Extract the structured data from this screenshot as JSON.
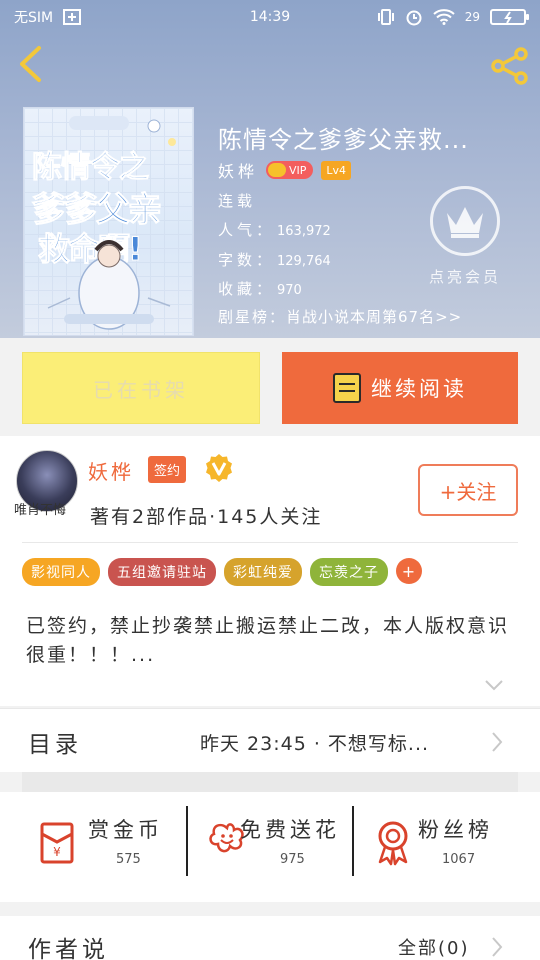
{
  "status_bar": {
    "carrier": "无SIM",
    "time": "14:39",
    "battery": "29"
  },
  "book": {
    "title": "陈情令之爹爹父亲救...",
    "cover_text_main": "陈情令之",
    "cover_text_sub": "爹爹父亲",
    "cover_text_last": "救命啊!",
    "author": "妖桦",
    "vip_label": "VIP",
    "level_label": "Lv4",
    "status": "连载",
    "popularity_label": "人气：",
    "popularity_value": "163,972",
    "words_label": "字数：",
    "words_value": "129,764",
    "favorites_label": "收藏：",
    "favorites_value": "970",
    "ranking_label": "剧星榜：",
    "ranking_value": "肖战小说本周第67名>>"
  },
  "member": {
    "label": "点亮会员"
  },
  "actions": {
    "shelf_label": "已在书架",
    "read_label": "继续阅读"
  },
  "author_card": {
    "name": "妖桦",
    "sign_badge": "签约",
    "avatar_caption": "唯肖不悔",
    "stats": "著有2部作品·145人关注",
    "follow_label": "+关注",
    "tags": [
      {
        "label": "影视同人",
        "color": "#f6a623"
      },
      {
        "label": "五组邀请驻站",
        "color": "#c9544f"
      },
      {
        "label": "彩虹纯爱",
        "color": "#d6a32c"
      },
      {
        "label": "忘羡之子",
        "color": "#8fb43a"
      },
      {
        "label": "+",
        "color": "#ef6a3d"
      }
    ],
    "synopsis": "已签约，禁止抄袭禁止搬运禁止二改，本人版权意识很重！！！..."
  },
  "catalog": {
    "title": "目录",
    "latest": "昨天  23:45 · 不想写标..."
  },
  "rewards": [
    {
      "label": "赏金币",
      "value": "575",
      "icon": "red-envelope-icon"
    },
    {
      "label": "免费送花",
      "value": "975",
      "icon": "flower-icon"
    },
    {
      "label": "粉丝榜",
      "value": "1067",
      "icon": "medal-icon"
    }
  ],
  "author_says": {
    "title": "作者说",
    "all_label": "全部(0)"
  },
  "colors": {
    "accent": "#ef6a3d",
    "shelf_bg": "#fbee77",
    "hero_top": "#8ea4c9"
  }
}
